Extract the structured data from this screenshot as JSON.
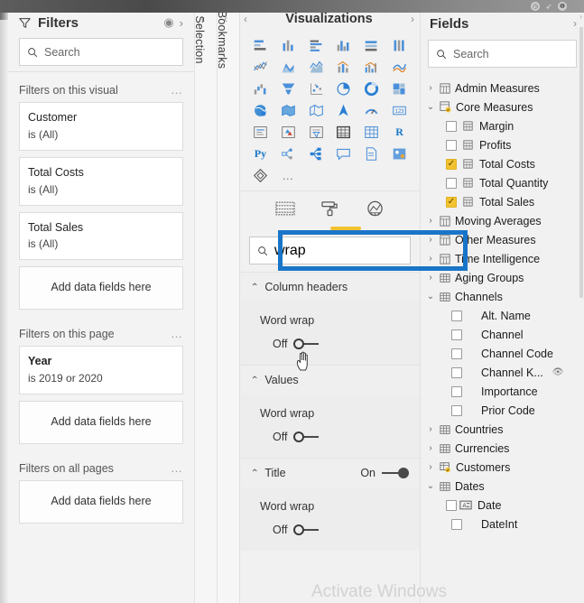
{
  "window": {
    "icons": [
      "clock-icon",
      "pin-icon",
      "info-icon"
    ],
    "scroll_up": "›"
  },
  "filters": {
    "title": "Filters",
    "funnel_icon": "funnel-icon",
    "eye_icon": "eye-icon",
    "expand_icon": "›",
    "search_placeholder": "Search",
    "search_icon": "search-icon",
    "sections": [
      {
        "label": "Filters on this visual",
        "menu": "…",
        "cards": [
          {
            "field": "Customer",
            "condition": "is (All)",
            "bold": false
          },
          {
            "field": "Total Costs",
            "condition": "is (All)",
            "bold": false
          },
          {
            "field": "Total Sales",
            "condition": "is (All)",
            "bold": false
          }
        ],
        "dropzone": "Add data fields here"
      },
      {
        "label": "Filters on this page",
        "menu": "…",
        "cards": [
          {
            "field": "Year",
            "condition": "is 2019 or 2020",
            "bold": true
          }
        ],
        "dropzone": "Add data fields here"
      },
      {
        "label": "Filters on all pages",
        "menu": "…",
        "cards": [],
        "dropzone": "Add data fields here"
      }
    ]
  },
  "collapsed_tabs": [
    {
      "label": "Selection",
      "chevron": "‹"
    },
    {
      "label": "Bookmarks",
      "chevron": "‹"
    }
  ],
  "visualizations": {
    "title": "Visualizations",
    "chevron_left": "‹",
    "chevron_right": "›",
    "gallery_icons": [
      "stacked-bar-chart-icon",
      "stacked-column-chart-icon",
      "clustered-bar-chart-icon",
      "clustered-column-chart-icon",
      "100-stacked-bar-chart-icon",
      "100-stacked-column-chart-icon",
      "line-chart-icon",
      "area-chart-icon",
      "stacked-area-chart-icon",
      "line-stacked-column-chart-icon",
      "line-clustered-column-chart-icon",
      "ribbon-chart-icon",
      "waterfall-chart-icon",
      "funnel-chart-icon",
      "scatter-chart-icon",
      "pie-chart-icon",
      "donut-chart-icon",
      "treemap-icon",
      "map-icon",
      "filled-map-icon",
      "shape-map-icon",
      "azure-map-icon",
      "gauge-icon",
      "card-icon",
      "multi-row-card-icon",
      "kpi-icon",
      "slicer-icon",
      "table-icon",
      "matrix-icon",
      "r-script-visual-icon",
      "python-visual-icon",
      "decomposition-tree-icon",
      "key-influencers-icon",
      "qa-visual-icon",
      "paginated-report-icon",
      "arcgis-map-icon",
      "power-apps-icon",
      "more-options-icon"
    ],
    "gallery_text_icons": {
      "r": "R",
      "py": "Py"
    },
    "pane_tabs": [
      {
        "name": "fields-tab",
        "icon": "table-fields-icon",
        "selected": false
      },
      {
        "name": "format-tab",
        "icon": "paint-roller-icon",
        "selected": true
      },
      {
        "name": "analytics-tab",
        "icon": "magnifier-analytics-icon",
        "selected": false
      }
    ],
    "format_search": {
      "icon": "search-icon",
      "value": "wrap",
      "placeholder": "Search"
    },
    "highlight_color": "#1a75c8",
    "selected_tab_color": "#f2c230",
    "format_sections": [
      {
        "name": "Column headers",
        "caret": "⌃",
        "has_header_toggle": false,
        "property": "Word wrap",
        "toggle_state": "Off",
        "toggle_on": false,
        "cursor": "hand-cursor"
      },
      {
        "name": "Values",
        "caret": "⌃",
        "has_header_toggle": false,
        "property": "Word wrap",
        "toggle_state": "Off",
        "toggle_on": false
      },
      {
        "name": "Title",
        "caret": "⌃",
        "has_header_toggle": true,
        "header_toggle_state": "On",
        "header_toggle_on": true,
        "property": "Word wrap",
        "toggle_state": "Off",
        "toggle_on": false
      }
    ]
  },
  "fields": {
    "title": "Fields",
    "chevron": "›",
    "search_placeholder": "Search",
    "search_icon": "search-icon",
    "tree": [
      {
        "label": "Admin Measures",
        "type": "measure-table",
        "level": 0,
        "expanded": false,
        "arrow": "›"
      },
      {
        "label": "Core Measures",
        "type": "measure-table",
        "level": 0,
        "expanded": true,
        "arrow": "⌄",
        "badge": true
      },
      {
        "label": "Margin",
        "type": "measure",
        "level": 1,
        "checked": false
      },
      {
        "label": "Profits",
        "type": "measure",
        "level": 1,
        "checked": false
      },
      {
        "label": "Total Costs",
        "type": "measure",
        "level": 1,
        "checked": true
      },
      {
        "label": "Total Quantity",
        "type": "measure",
        "level": 1,
        "checked": false
      },
      {
        "label": "Total Sales",
        "type": "measure",
        "level": 1,
        "checked": true
      },
      {
        "label": "Moving Averages",
        "type": "measure-table",
        "level": 0,
        "expanded": false,
        "arrow": "›"
      },
      {
        "label": "Other Measures",
        "type": "measure-table",
        "level": 0,
        "expanded": false,
        "arrow": "›"
      },
      {
        "label": "Time Intelligence",
        "type": "measure-table",
        "level": 0,
        "expanded": false,
        "arrow": "›"
      },
      {
        "label": "Aging Groups",
        "type": "table",
        "level": 0,
        "expanded": false,
        "arrow": "›"
      },
      {
        "label": "Channels",
        "type": "table",
        "level": 0,
        "expanded": true,
        "arrow": "⌄"
      },
      {
        "label": "Alt. Name",
        "type": "column",
        "level": 1,
        "checked": false
      },
      {
        "label": "Channel",
        "type": "column",
        "level": 1,
        "checked": false
      },
      {
        "label": "Channel Code",
        "type": "column",
        "level": 1,
        "checked": false
      },
      {
        "label": "Channel K...",
        "type": "column",
        "level": 1,
        "checked": false,
        "hidden_icon": true
      },
      {
        "label": "Importance",
        "type": "column",
        "level": 1,
        "checked": false
      },
      {
        "label": "Prior Code",
        "type": "column",
        "level": 1,
        "checked": false
      },
      {
        "label": "Countries",
        "type": "table",
        "level": 0,
        "expanded": false,
        "arrow": "›"
      },
      {
        "label": "Currencies",
        "type": "table",
        "level": 0,
        "expanded": false,
        "arrow": "›"
      },
      {
        "label": "Customers",
        "type": "table",
        "level": 0,
        "expanded": false,
        "arrow": "›",
        "badge": true
      },
      {
        "label": "Dates",
        "type": "table",
        "level": 0,
        "expanded": true,
        "arrow": "⌄"
      },
      {
        "label": "Date",
        "type": "date-column",
        "level": 1,
        "checked": false
      },
      {
        "label": "DateInt",
        "type": "column",
        "level": 1,
        "checked": false
      }
    ]
  },
  "watermark": "Activate Windows"
}
